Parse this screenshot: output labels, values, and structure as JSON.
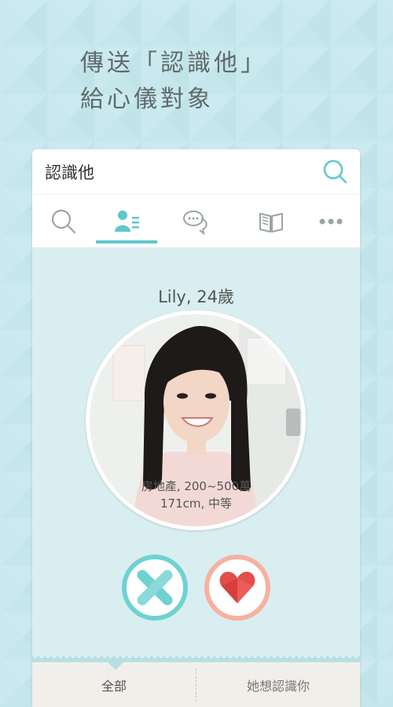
{
  "promo": {
    "line1": "傳送「認識他」",
    "line2": "給心儀對象"
  },
  "app": {
    "title": "認識他"
  },
  "tabs": [
    {
      "icon": "search-icon",
      "active": false
    },
    {
      "icon": "profile-list-icon",
      "active": true
    },
    {
      "icon": "chat-icon",
      "active": false
    },
    {
      "icon": "book-icon",
      "active": false
    },
    {
      "icon": "more-icon",
      "active": false
    }
  ],
  "profile": {
    "name": "Lily, 24歲",
    "occupation_income": "房地產, 200~500萬",
    "height_build": "171cm, 中等"
  },
  "bottom_tabs": {
    "all": "全部",
    "she_wants": "她想認識你"
  },
  "colors": {
    "background": "#c5e7ec",
    "accent": "#5fc8cb",
    "like": "#e34d4a",
    "like_ring": "#f7b0a1",
    "pass_ring": "#6fd2d2"
  }
}
